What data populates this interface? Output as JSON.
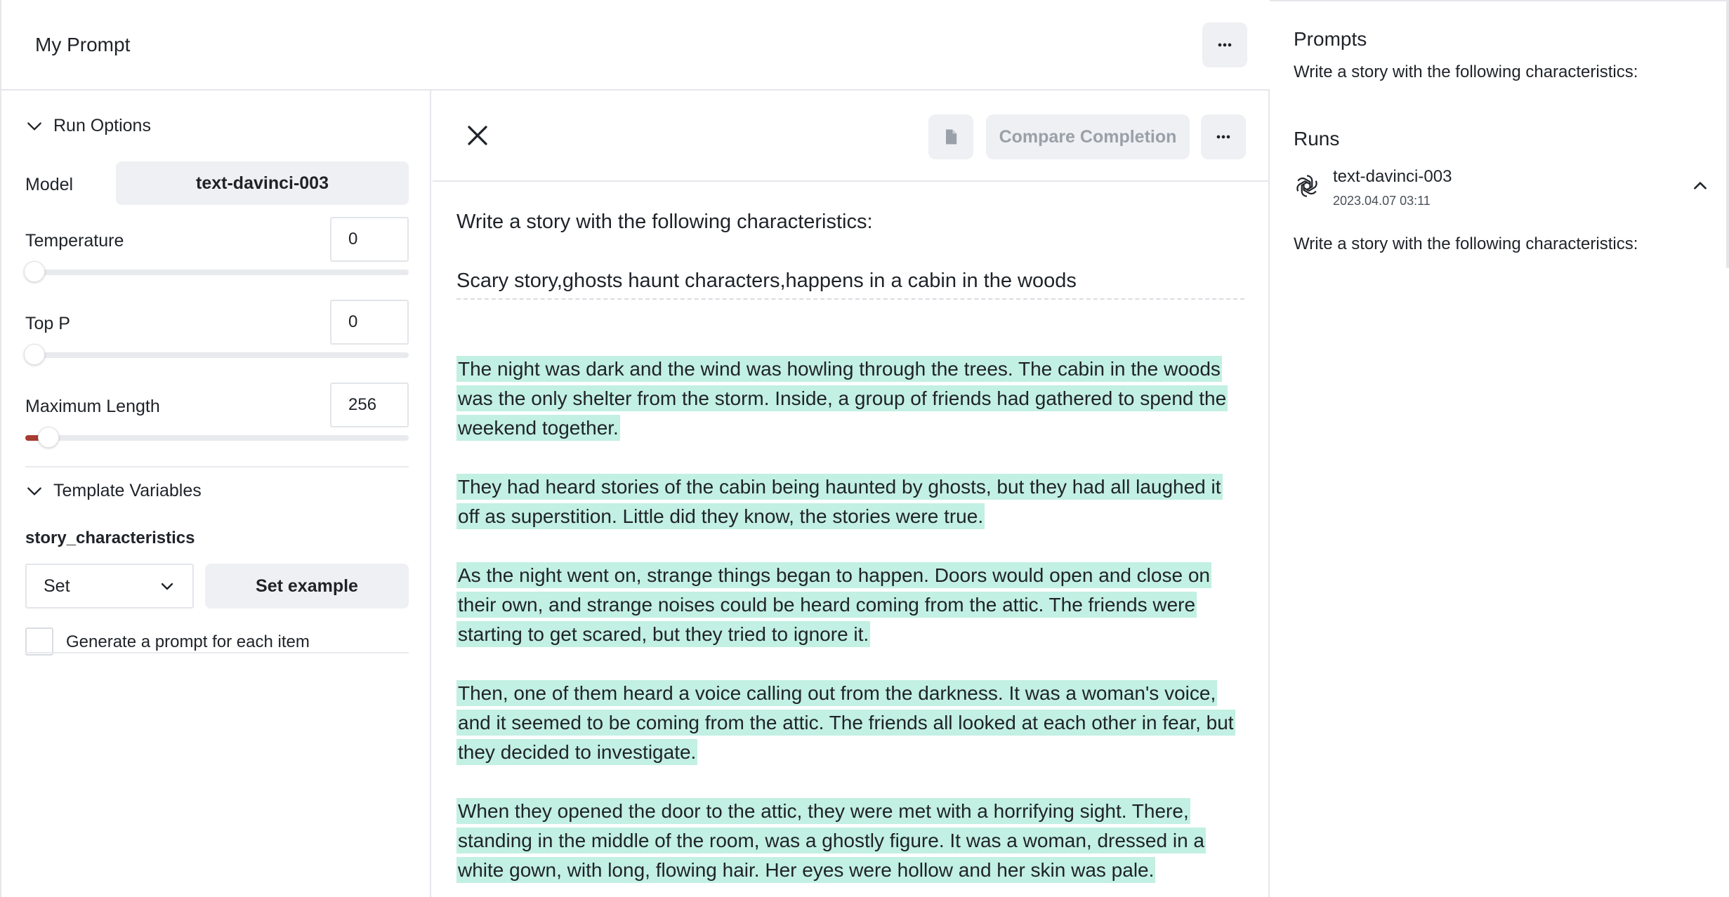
{
  "header": {
    "title": "My Prompt",
    "more_icon": "ellipsis-icon"
  },
  "run_options": {
    "section_label": "Run Options",
    "model_label": "Model",
    "model_value": "text-davinci-003",
    "temperature_label": "Temperature",
    "temperature_value": "0",
    "temperature_fraction": 0,
    "top_p_label": "Top P",
    "top_p_value": "0",
    "top_p_fraction": 0,
    "max_length_label": "Maximum Length",
    "max_length_value": "256",
    "max_length_fraction": 0.06
  },
  "template_variables": {
    "section_label": "Template Variables",
    "variable_name": "story_characteristics",
    "select_value": "Set",
    "set_example_label": "Set example",
    "checkbox_label": "Generate a prompt for each item",
    "checkbox_checked": false
  },
  "completion_toolbar": {
    "compare_label": "Compare Completion",
    "close_icon": "close-icon",
    "doc_icon": "document-icon",
    "more_icon": "ellipsis-icon"
  },
  "prompt": {
    "line1": "Write a story with the following characteristics:",
    "line2": "Scary story,ghosts haunt characters,happens in a cabin in the woods"
  },
  "completion": {
    "paragraphs": [
      "The night was dark and the wind was howling through the trees. The cabin in the woods was the only shelter from the storm. Inside, a group of friends had gathered to spend the weekend together.",
      "They had heard stories of the cabin being haunted by ghosts, but they had all laughed it off as superstition. Little did they know, the stories were true.",
      "As the night went on, strange things began to happen. Doors would open and close on their own, and strange noises could be heard coming from the attic. The friends were starting to get scared, but they tried to ignore it.",
      "Then, one of them heard a voice calling out from the darkness. It was a woman's voice, and it seemed to be coming from the attic. The friends all looked at each other in fear, but they decided to investigate.",
      "When they opened the door to the attic, they were met with a horrifying sight. There, standing in the middle of the room, was a ghostly figure. It was a woman, dressed in a white gown, with long, flowing hair. Her eyes were hollow and her skin was pale."
    ],
    "highlight_color": "#c2f0e2"
  },
  "sidebar": {
    "prompts_heading": "Prompts",
    "prompt_text": "Write a story with the following characteristics:",
    "runs_heading": "Runs",
    "run": {
      "model": "text-davinci-003",
      "date": "2023.04.07 03:11",
      "logo_icon": "openai-logo-icon",
      "expanded": true
    },
    "run_text": "Write a story with the following characteristics:"
  },
  "colors": {
    "accent_slider": "#a83b2f",
    "button_bg": "#eef0f3",
    "border": "#e5e7eb"
  }
}
